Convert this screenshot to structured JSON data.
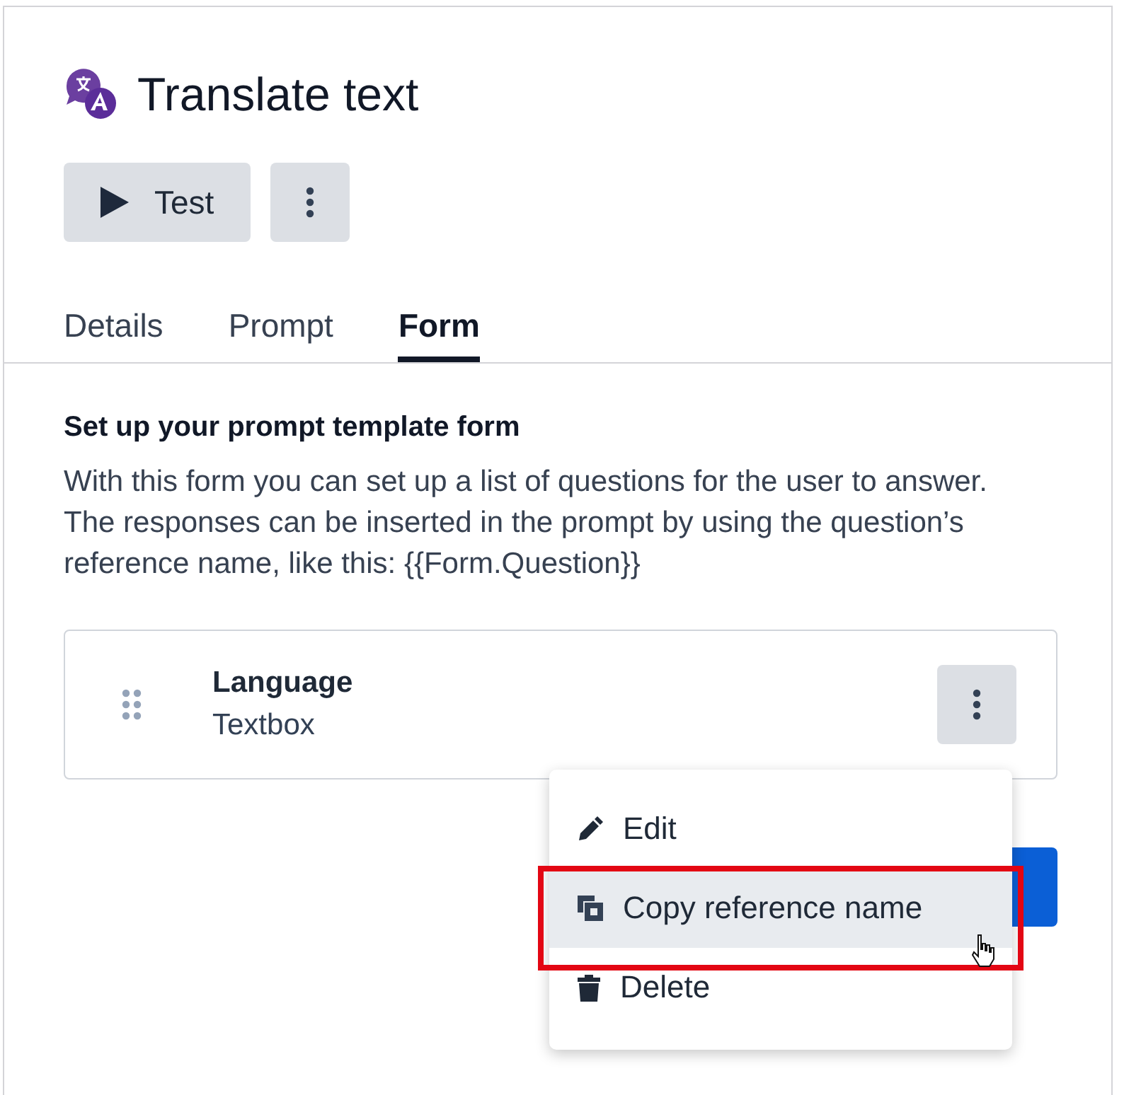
{
  "header": {
    "title": "Translate text"
  },
  "actions": [
    {
      "kind": "test",
      "label": "Test"
    },
    {
      "kind": "more"
    }
  ],
  "tabs": [
    {
      "label": "Details",
      "selected": false
    },
    {
      "label": "Prompt",
      "selected": false
    },
    {
      "label": "Form",
      "selected": true
    }
  ],
  "section": {
    "title": "Set up your prompt template form",
    "description": "With this form you can set up a list of questions for the user to answer. The responses can be inserted in the prompt by using the question’s reference name, like this: {{Form.Question}}"
  },
  "questions": [
    {
      "name": "Language",
      "type": "Textbox"
    }
  ],
  "menu": [
    {
      "kind": "edit",
      "label": "Edit",
      "selected": false
    },
    {
      "kind": "copy",
      "label": "Copy reference name",
      "selected": true
    },
    {
      "kind": "delete",
      "label": "Delete",
      "selected": false
    }
  ]
}
